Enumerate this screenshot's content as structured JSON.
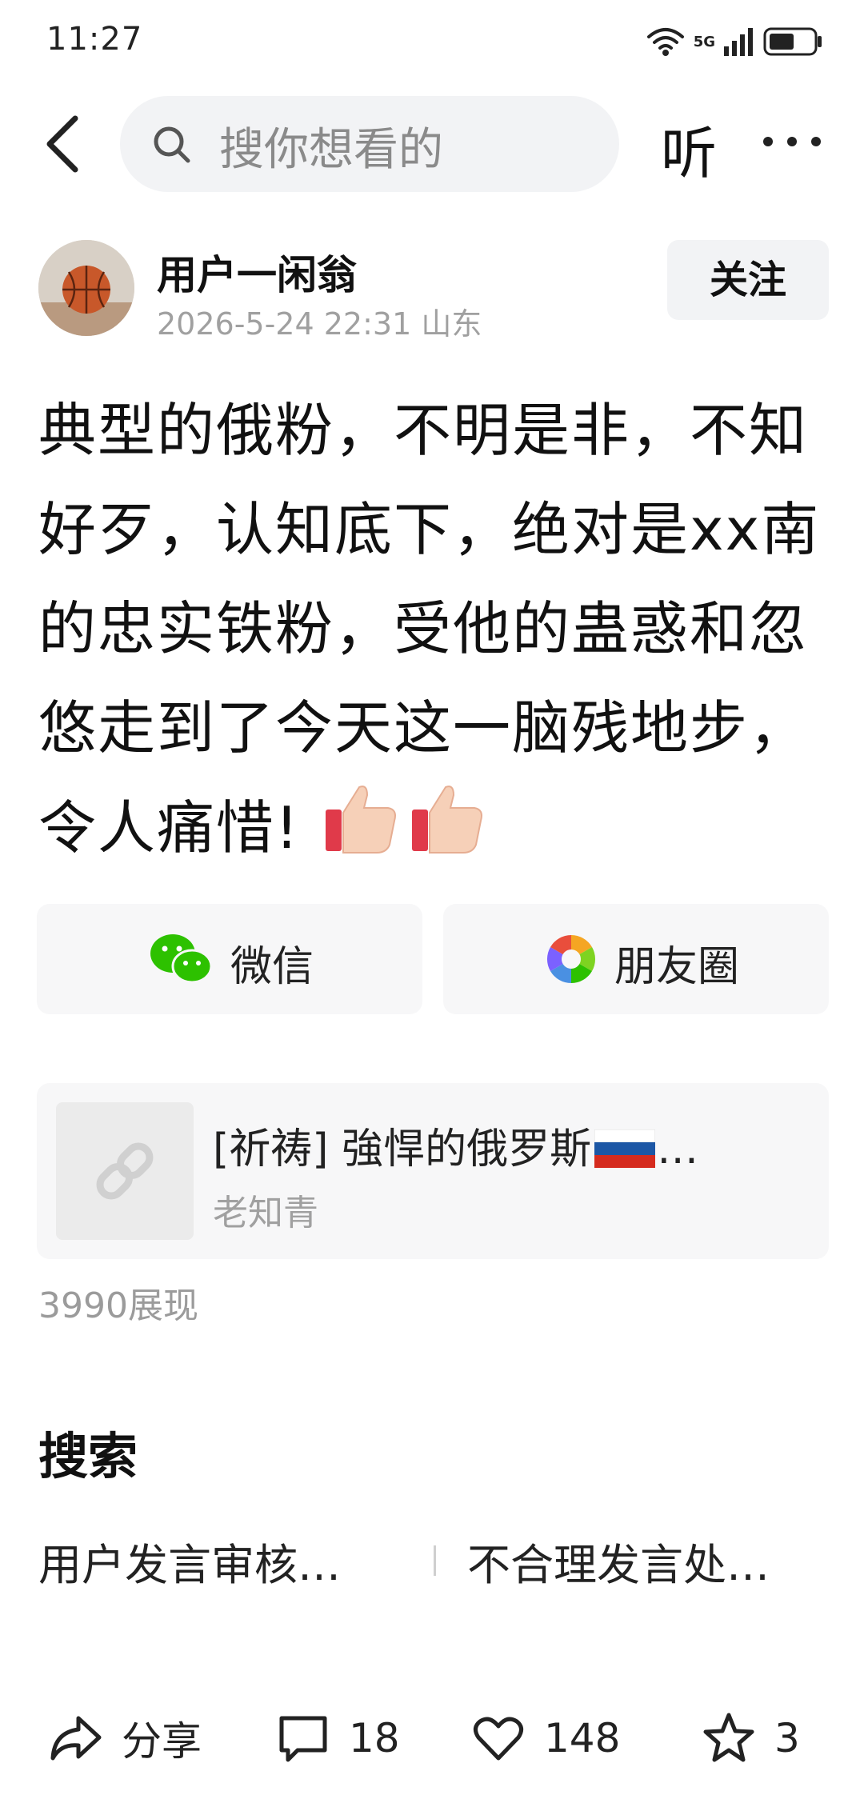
{
  "status_bar": {
    "time": "11:27",
    "network": "5G",
    "icons": [
      "wifi-icon",
      "signal-icon",
      "battery-icon"
    ]
  },
  "header": {
    "search_placeholder": "搜你想看的",
    "listen_label": "听",
    "icons": [
      "back-icon",
      "search-icon",
      "more-icon"
    ]
  },
  "author": {
    "name": "用户一闲翁",
    "meta": "2026-5-24 22:31 山东",
    "follow_label": "关注"
  },
  "post": {
    "text": "典型的俄粉，不明是非，不知好歹，认知底下，绝对是xx南的忠实铁粉，受他的蛊惑和忽悠走到了今天这一脑残地步，令人痛惜!",
    "emojis": [
      "thumbs-up",
      "thumbs-up"
    ]
  },
  "share": {
    "wechat_label": "微信",
    "moments_label": "朋友圈"
  },
  "link_card": {
    "title_prefix": "[祈祷] 強悍的俄罗斯",
    "title_suffix": "…",
    "source": "老知青"
  },
  "stats": {
    "views": "3990展现"
  },
  "search_section": {
    "title": "搜索",
    "suggestions": [
      "用户发言审核…",
      "不合理发言处…"
    ]
  },
  "actions": {
    "share_label": "分享",
    "comments": "18",
    "likes": "148",
    "stars": "3"
  },
  "colors": {
    "wechat_green": "#2dc100",
    "muted_text": "#a0a0a0",
    "card_bg": "#f7f7f8",
    "search_bg": "#f2f3f5"
  }
}
